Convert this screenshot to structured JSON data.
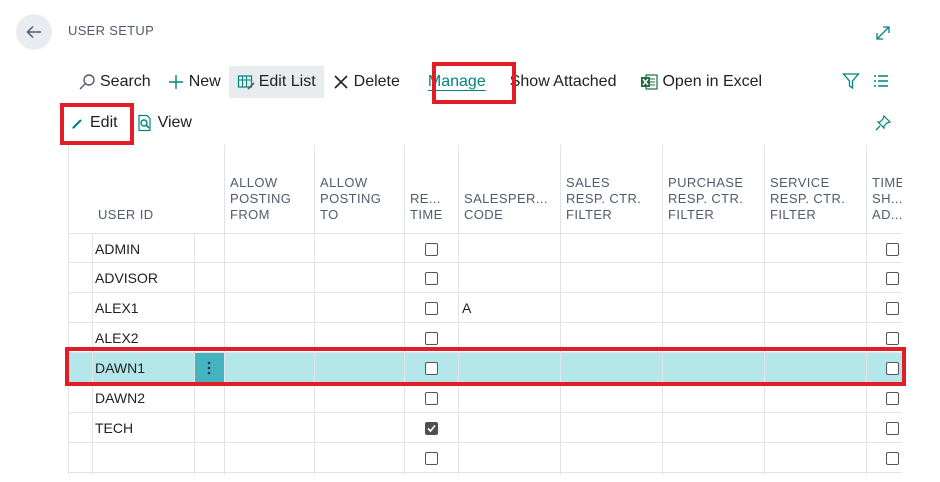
{
  "page": {
    "title": "USER SETUP"
  },
  "actions": {
    "search": "Search",
    "new": "New",
    "edit_list": "Edit List",
    "delete": "Delete",
    "manage": "Manage",
    "show_attached": "Show Attached",
    "open_excel": "Open in Excel",
    "edit": "Edit",
    "view": "View"
  },
  "table": {
    "columns": {
      "user_id": "USER ID",
      "allow_from": "ALLOW\nPOSTING\nFROM",
      "allow_to": "ALLOW\nPOSTING\nTO",
      "reg_time": "RE...\nTIME",
      "salesperson": "SALESPER...\nCODE",
      "sales_resp": "SALES\nRESP. CTR.\nFILTER",
      "purchase_resp": "PURCHASE\nRESP. CTR.\nFILTER",
      "service_resp": "SERVICE\nRESP. CTR.\nFILTER",
      "time_sheet": "TIME\nSH...\nAD..."
    },
    "rows": [
      {
        "user_id": "ADMIN",
        "reg_time": false,
        "salesperson": "",
        "time_sheet": false,
        "selected": false
      },
      {
        "user_id": "ADVISOR",
        "reg_time": false,
        "salesperson": "",
        "time_sheet": false,
        "selected": false
      },
      {
        "user_id": "ALEX1",
        "reg_time": false,
        "salesperson": "A",
        "time_sheet": false,
        "selected": false
      },
      {
        "user_id": "ALEX2",
        "reg_time": false,
        "salesperson": "",
        "time_sheet": false,
        "selected": false
      },
      {
        "user_id": "DAWN1",
        "reg_time": false,
        "salesperson": "",
        "time_sheet": false,
        "selected": true
      },
      {
        "user_id": "DAWN2",
        "reg_time": false,
        "salesperson": "",
        "time_sheet": false,
        "selected": false
      },
      {
        "user_id": "TECH",
        "reg_time": true,
        "salesperson": "",
        "time_sheet": false,
        "selected": false
      },
      {
        "user_id": "",
        "reg_time": false,
        "salesperson": "",
        "time_sheet": false,
        "selected": false
      }
    ]
  },
  "colors": {
    "accent": "#00847c",
    "highlight": "#e01e27",
    "selected_row": "#b3e7ea",
    "row_menu": "#44b5bf"
  },
  "icons": [
    "back-arrow-icon",
    "expand-icon",
    "search-icon",
    "plus-icon",
    "edit-list-icon",
    "delete-x-icon",
    "excel-icon",
    "filter-icon",
    "list-view-icon",
    "pencil-icon",
    "view-icon",
    "pin-icon",
    "row-menu-icon",
    "checkmark-icon"
  ]
}
